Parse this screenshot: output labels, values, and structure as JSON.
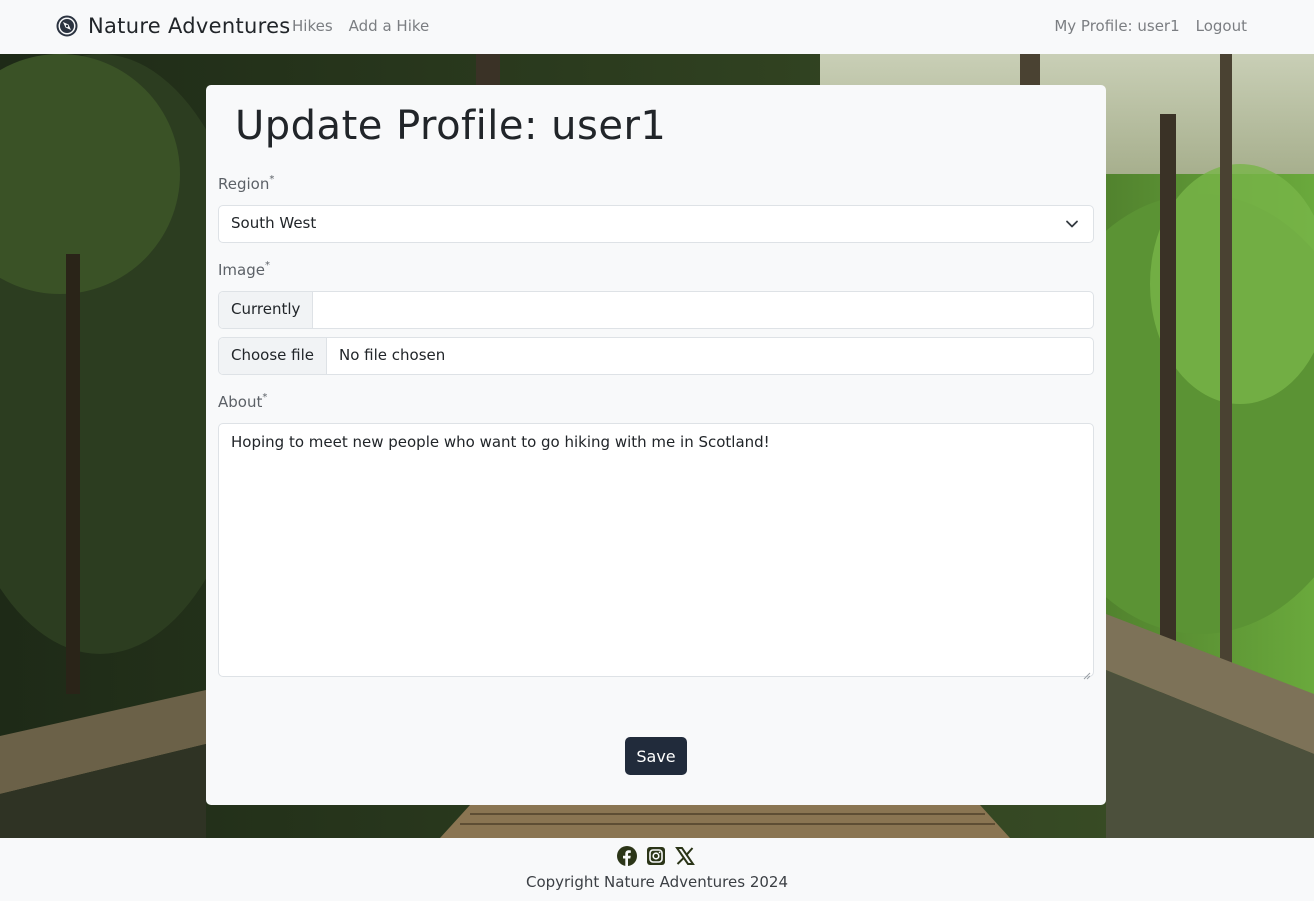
{
  "navbar": {
    "brand": "Nature Adventures",
    "links_left": [
      "Hikes",
      "Add a Hike"
    ],
    "links_right": [
      "My Profile: user1",
      "Logout"
    ]
  },
  "form": {
    "title": "Update Profile: user1",
    "region": {
      "label": "Region",
      "required_mark": "*",
      "value": "South West"
    },
    "image": {
      "label": "Image",
      "required_mark": "*",
      "current_label": "Currently",
      "current_value": "",
      "choose_button": "Choose file",
      "file_status": "No file chosen"
    },
    "about": {
      "label": "About",
      "required_mark": "*",
      "value": "Hoping to meet new people who want to go hiking with me in Scotland!"
    },
    "save_label": "Save"
  },
  "footer": {
    "socials": [
      "facebook-icon",
      "instagram-icon",
      "x-icon"
    ],
    "copyright": "Copyright Nature Adventures 2024"
  },
  "colors": {
    "nav_bg": "#f8f9fa",
    "button_bg": "#212b3b",
    "link": "#7b7e82"
  }
}
